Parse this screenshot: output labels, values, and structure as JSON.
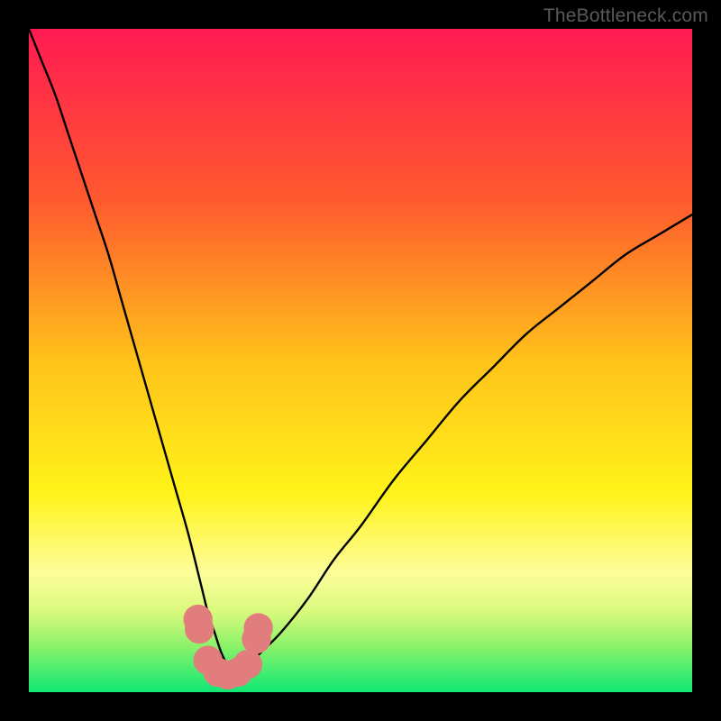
{
  "watermark": "TheBottleneck.com",
  "chart_data": {
    "type": "line",
    "title": "",
    "xlabel": "",
    "ylabel": "",
    "xlim": [
      0,
      100
    ],
    "ylim": [
      0,
      100
    ],
    "grid": false,
    "legend": false,
    "gradient_stops": [
      {
        "offset": 0,
        "color": "#ff1a52"
      },
      {
        "offset": 0.26,
        "color": "#ff5a2e"
      },
      {
        "offset": 0.5,
        "color": "#ffc21a"
      },
      {
        "offset": 0.7,
        "color": "#fff31a"
      },
      {
        "offset": 0.82,
        "color": "#fdfd9a"
      },
      {
        "offset": 0.88,
        "color": "#d8f97c"
      },
      {
        "offset": 0.93,
        "color": "#8cf26a"
      },
      {
        "offset": 1.0,
        "color": "#0fe874"
      }
    ],
    "series": [
      {
        "name": "bottleneck-curve",
        "color": "#000000",
        "x": [
          0,
          2,
          4,
          6,
          8,
          10,
          12,
          14,
          16,
          18,
          20,
          22,
          24,
          26,
          27,
          28,
          29,
          30,
          31,
          32,
          33,
          35,
          38,
          42,
          46,
          50,
          55,
          60,
          65,
          70,
          75,
          80,
          85,
          90,
          95,
          100
        ],
        "y": [
          100,
          95,
          90,
          84,
          78,
          72,
          66,
          59,
          52,
          45,
          38,
          31,
          24,
          16,
          12,
          9,
          6,
          4,
          3,
          3,
          4,
          6,
          9,
          14,
          20,
          25,
          32,
          38,
          44,
          49,
          54,
          58,
          62,
          66,
          69,
          72
        ]
      }
    ],
    "markers": {
      "name": "highlight-dots",
      "color": "#e27d7d",
      "radius": 2.2,
      "points": [
        {
          "x": 25.5,
          "y": 11.0
        },
        {
          "x": 25.7,
          "y": 9.5
        },
        {
          "x": 27.0,
          "y": 4.8
        },
        {
          "x": 28.5,
          "y": 3.0
        },
        {
          "x": 30.0,
          "y": 2.6
        },
        {
          "x": 31.5,
          "y": 3.0
        },
        {
          "x": 33.0,
          "y": 4.2
        },
        {
          "x": 34.3,
          "y": 8.0
        },
        {
          "x": 34.6,
          "y": 9.7
        }
      ]
    }
  }
}
